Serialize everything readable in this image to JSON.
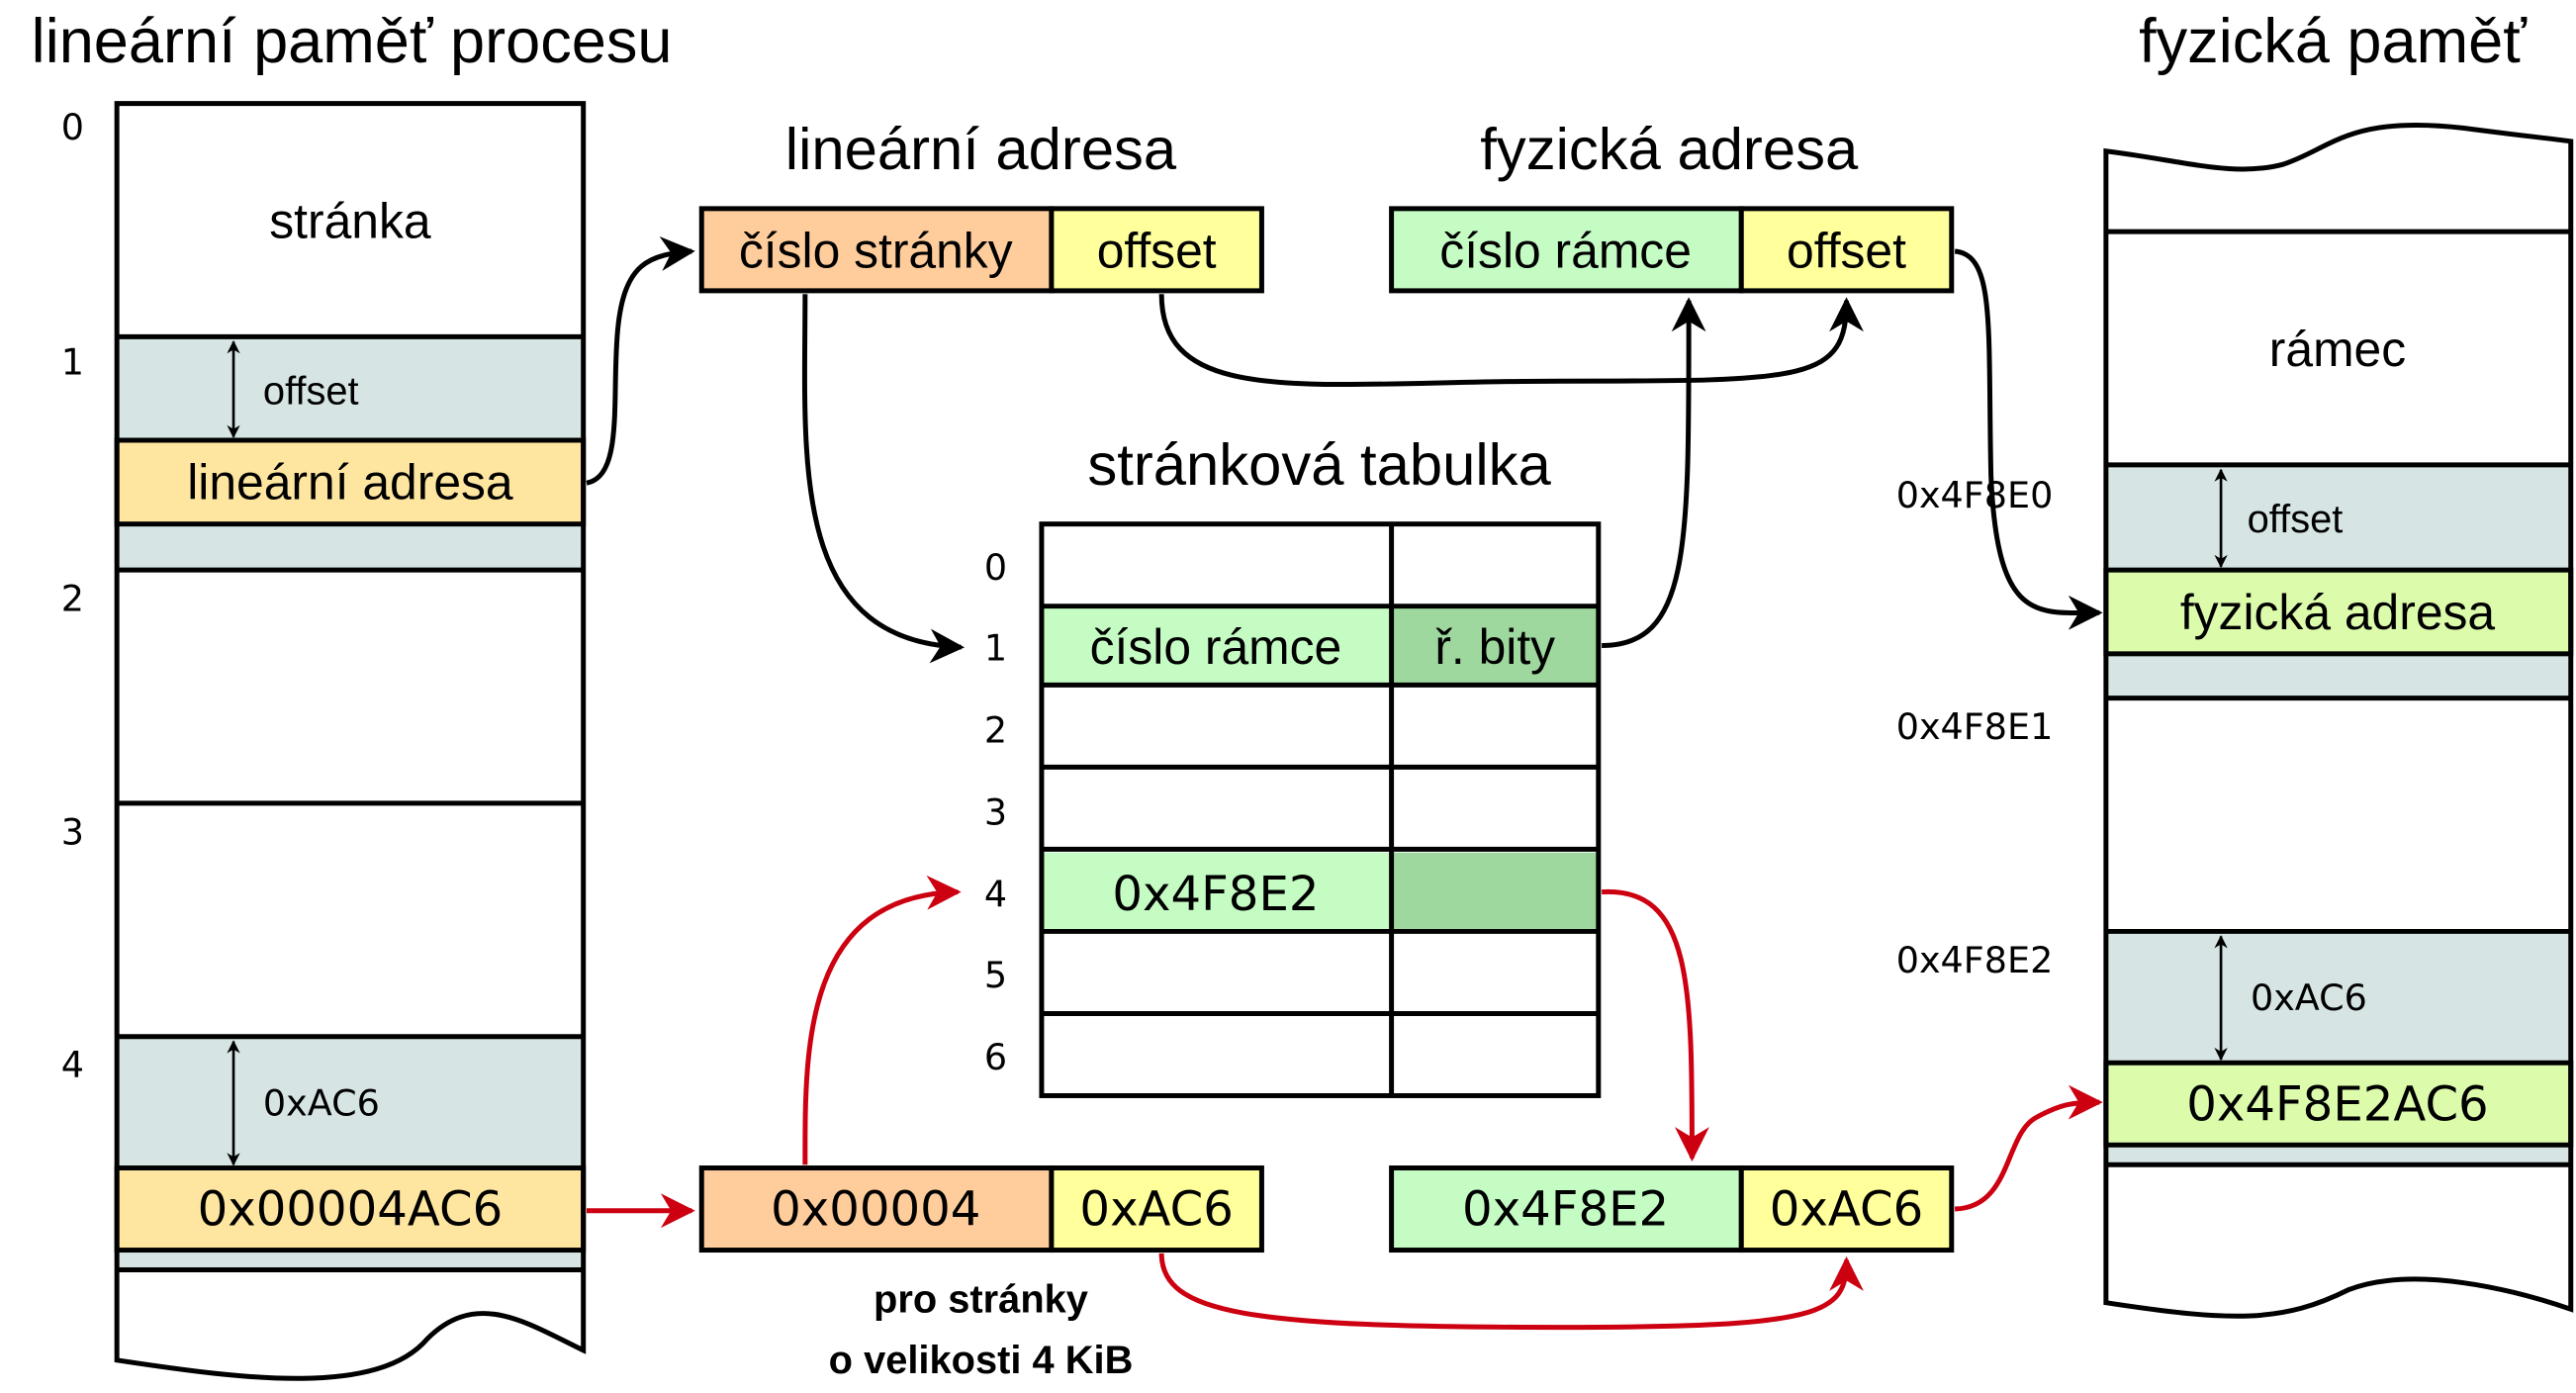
{
  "colors": {
    "offset_region": "#d6e4e4",
    "linear_addr": "#ffe6a0",
    "page_number": "#ffcd9c",
    "offset": "#ffff9c",
    "frame_number": "#c4fcc4",
    "control_bits": "#9ed89e",
    "physical_addr": "#dcfcac",
    "black_arrow": "#000000",
    "red_arrow": "#cc0010"
  },
  "linear_memory": {
    "title": "lineární paměť procesu",
    "page_indices": [
      "0",
      "1",
      "2",
      "3",
      "4"
    ],
    "page_label": "stránka",
    "offset_label": "offset",
    "linear_address_label": "lineární adresa",
    "example_offset": "0xAC6",
    "example_address": "0x00004AC6"
  },
  "linear_address": {
    "title": "lineární adresa",
    "page_number_label": "číslo stránky",
    "offset_label": "offset",
    "example_page_number": "0x00004",
    "example_offset": "0xAC6",
    "note_line1": "pro stránky",
    "note_line2": "o velikosti 4 KiB"
  },
  "physical_address": {
    "title": "fyzická adresa",
    "frame_number_label": "číslo rámce",
    "offset_label": "offset",
    "example_frame_number": "0x4F8E2",
    "example_offset": "0xAC6"
  },
  "page_table": {
    "title": "stránková tabulka",
    "row_indices": [
      "0",
      "1",
      "2",
      "3",
      "4",
      "5",
      "6"
    ],
    "rows": [
      {
        "frame": "",
        "bits": ""
      },
      {
        "frame": "číslo rámce",
        "bits": "ř. bity"
      },
      {
        "frame": "",
        "bits": ""
      },
      {
        "frame": "",
        "bits": ""
      },
      {
        "frame": "0x4F8E2",
        "bits": ""
      },
      {
        "frame": "",
        "bits": ""
      },
      {
        "frame": "",
        "bits": ""
      }
    ]
  },
  "physical_memory": {
    "title": "fyzická paměť",
    "frame_label": "rámec",
    "offset_label": "offset",
    "physical_address_label": "fyzická adresa",
    "frame_addresses": [
      "0x4F8E0",
      "0x4F8E1",
      "0x4F8E2"
    ],
    "example_offset": "0xAC6",
    "example_address": "0x4F8E2AC6"
  }
}
